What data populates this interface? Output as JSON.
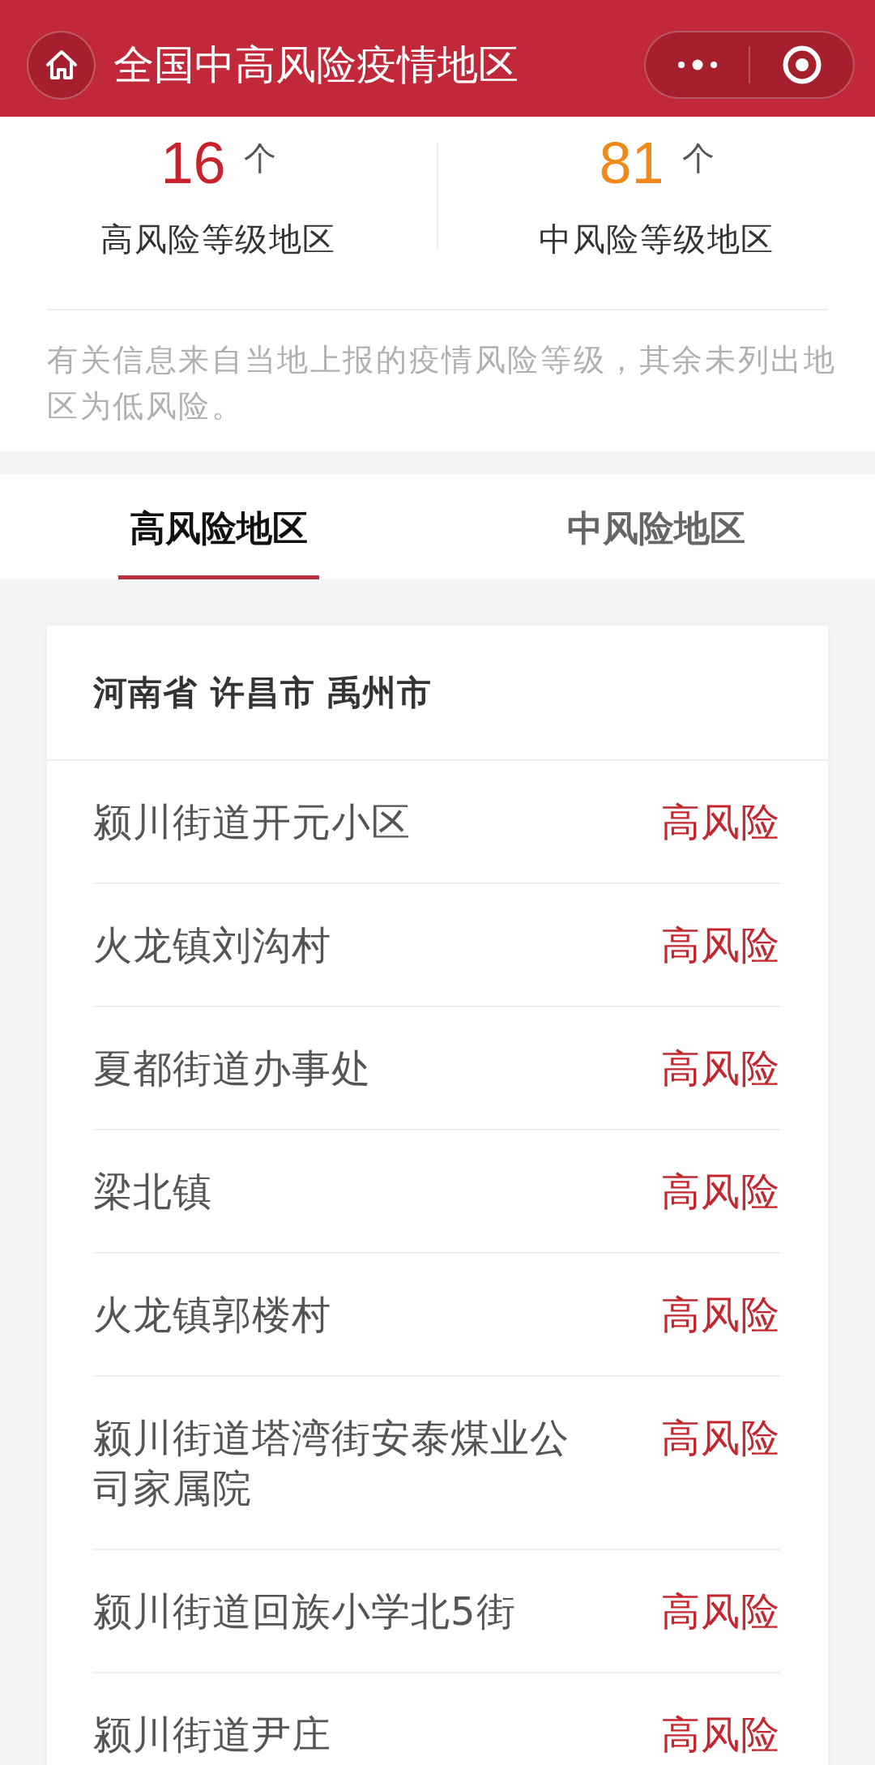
{
  "header": {
    "title": "全国中高风险疫情地区"
  },
  "summary": {
    "stats": [
      {
        "kind": "high",
        "count": "16",
        "unit": "个",
        "label": "高风险等级地区"
      },
      {
        "kind": "medium",
        "count": "81",
        "unit": "个",
        "label": "中风险等级地区"
      }
    ],
    "note": "有关信息来自当地上报的疫情风险等级，其余未列出地区为低风险。"
  },
  "tabs": [
    {
      "label": "高风险地区",
      "selected": true
    },
    {
      "label": "中风险地区",
      "selected": false
    }
  ],
  "regions": [
    {
      "title": "河南省 许昌市 禹州市",
      "items": [
        {
          "name": "颍川街道开元小区",
          "risk": "高风险",
          "kind": "high"
        },
        {
          "name": "火龙镇刘沟村",
          "risk": "高风险",
          "kind": "high"
        },
        {
          "name": "夏都街道办事处",
          "risk": "高风险",
          "kind": "high"
        },
        {
          "name": "梁北镇",
          "risk": "高风险",
          "kind": "high"
        },
        {
          "name": "火龙镇郭楼村",
          "risk": "高风险",
          "kind": "high"
        },
        {
          "name": "颍川街道塔湾街安泰煤业公司家属院",
          "risk": "高风险",
          "kind": "high"
        },
        {
          "name": "颍川街道回族小学北5街",
          "risk": "高风险",
          "kind": "high"
        },
        {
          "name": "颍川街道尹庄",
          "risk": "高风险",
          "kind": "high"
        }
      ]
    }
  ]
}
